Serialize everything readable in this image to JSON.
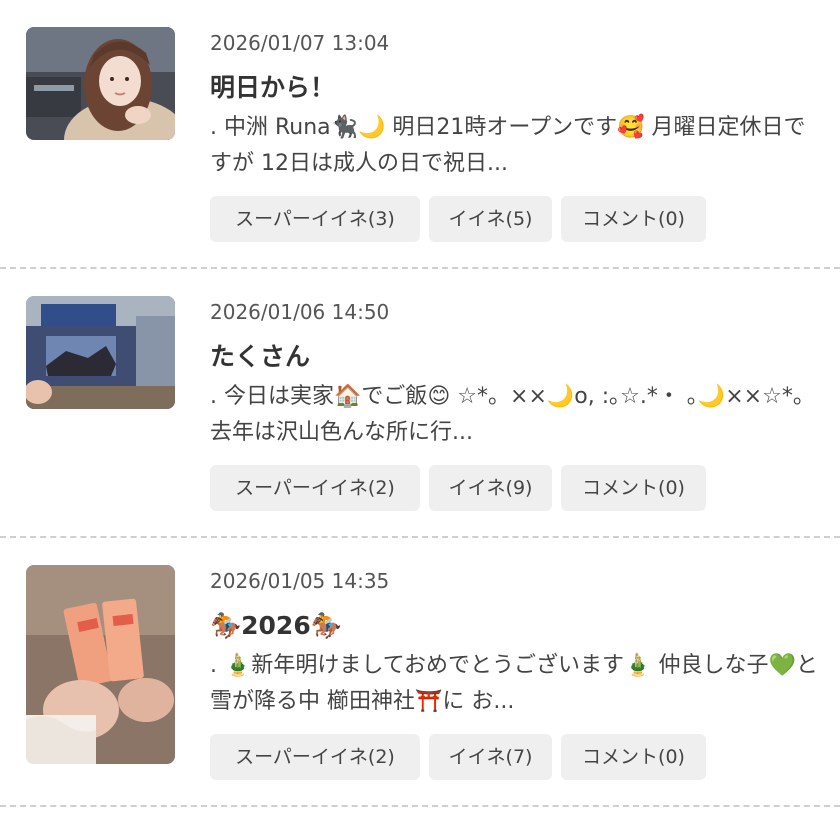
{
  "posts": [
    {
      "date": "2026/01/07 13:04",
      "title": "明日から！",
      "excerpt": ". 中洲 Runa🐈‍⬛🌙 明日21時オープンです🥰 月曜日定休日ですが 12日は成人の日で祝日...",
      "super_like": "スーパーイイネ(3)",
      "like": "イイネ(5)",
      "comment": "コメント(0)"
    },
    {
      "date": "2026/01/06 14:50",
      "title": "たくさん",
      "excerpt": ". 今日は実家🏠でご飯😊 ☆*。××🌙o, :｡☆.*・ ｡🌙××☆*。 去年は沢山色んな所に行...",
      "super_like": "スーパーイイネ(2)",
      "like": "イイネ(9)",
      "comment": "コメント(0)"
    },
    {
      "date": "2026/01/05 14:35",
      "title": "🏇2026🏇",
      "excerpt": ". 🎍新年明けましておめでとうございます🎍 仲良しな子💚と雪が降る中 櫛田神社⛩️に お...",
      "super_like": "スーパーイイネ(2)",
      "like": "イイネ(7)",
      "comment": "コメント(0)"
    }
  ]
}
